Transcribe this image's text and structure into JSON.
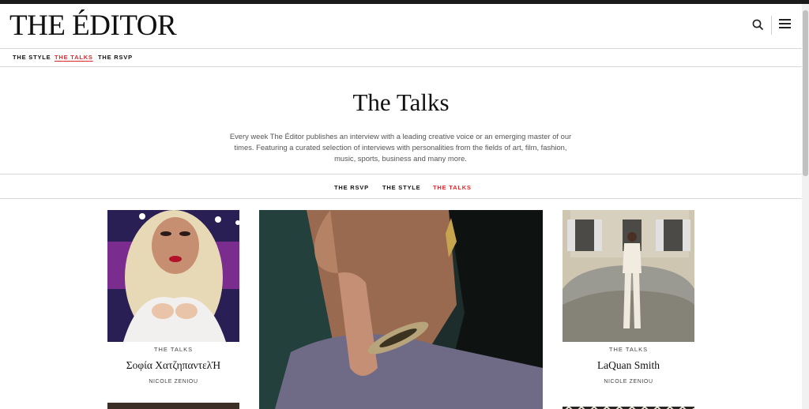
{
  "header": {
    "logo": "THE ÉDITOR",
    "search_icon": "search-icon",
    "menu_icon": "hamburger-menu-icon"
  },
  "subnav": {
    "items": [
      {
        "label": "THE STYLE",
        "active": false
      },
      {
        "label": "THE TALKS",
        "active": true
      },
      {
        "label": "THE RSVP",
        "active": false
      }
    ]
  },
  "main": {
    "title": "The Talks",
    "intro": "Every week The Éditor publishes an interview with a leading creative voice or an emerging master of our times. Featuring a curated selection of interviews with personalities from the fields of art, film, fashion, music, sports, business and many more."
  },
  "filters": {
    "items": [
      {
        "label": "THE RSVP",
        "active": false
      },
      {
        "label": "THE STYLE",
        "active": false
      },
      {
        "label": "THE TALKS",
        "active": true
      }
    ]
  },
  "cards": [
    {
      "category": "THE TALKS",
      "name": "Σοφία ΧατζηπαντελΉ",
      "author": "NICOLE ZENIOU"
    },
    {
      "category": "THE TALKS",
      "name": "LaQuan Smith",
      "author": "NICOLE ZENIOU"
    }
  ],
  "colors": {
    "accent": "#e0262c",
    "topbar": "#1b1b1b"
  }
}
